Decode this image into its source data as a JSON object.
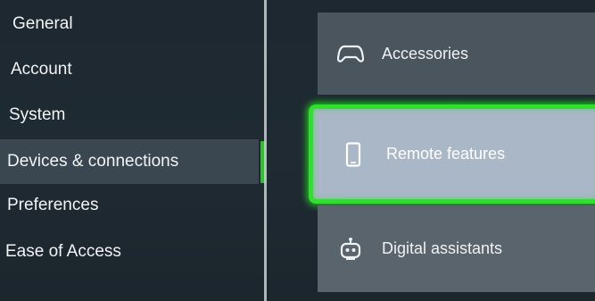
{
  "nav": {
    "items": [
      {
        "label": "General"
      },
      {
        "label": "Account"
      },
      {
        "label": "System"
      },
      {
        "label": "Devices & connections",
        "selected": true
      },
      {
        "label": "Preferences"
      },
      {
        "label": "Ease of Access"
      }
    ]
  },
  "cards": [
    {
      "label": "Accessories",
      "icon": "gamepad-icon"
    },
    {
      "label": "Remote features",
      "icon": "phone-icon",
      "focused": true
    },
    {
      "label": "Digital assistants",
      "icon": "robot-icon"
    }
  ],
  "colors": {
    "background": "#1e2a32",
    "focus_border": "#2fe02f",
    "selected_indicator": "#2fbf2f",
    "selected_nav_bg": "#3a4750",
    "focused_card_bg": "#a9b7c6"
  }
}
